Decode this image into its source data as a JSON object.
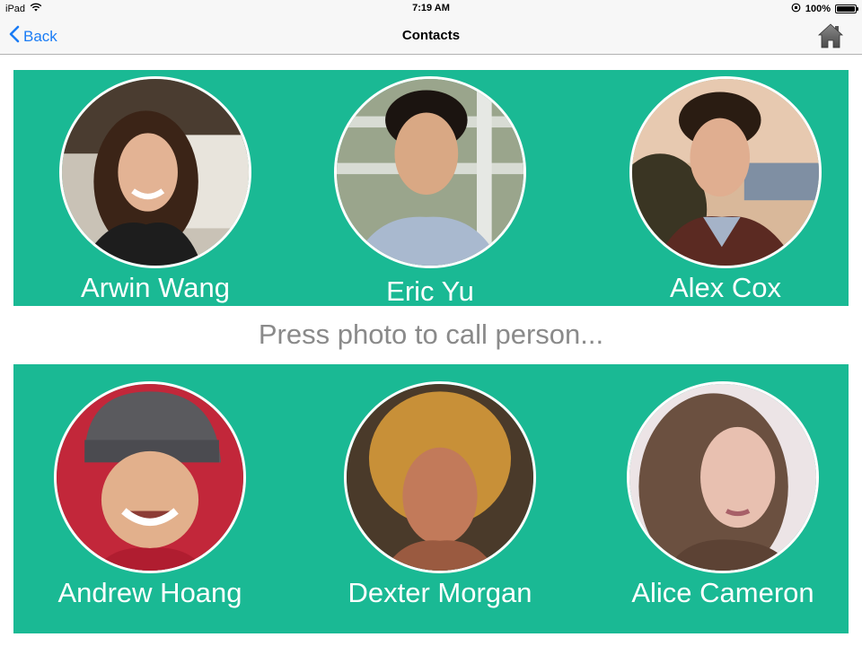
{
  "status_bar": {
    "device": "iPad",
    "time": "7:19 AM",
    "battery": "100%",
    "battery_level": 1.0
  },
  "nav": {
    "back_label": "Back",
    "title": "Contacts",
    "home_icon": "home-icon"
  },
  "hint": "Press photo to call person...",
  "contacts": [
    {
      "name": "Arwin Wang"
    },
    {
      "name": "Eric Yu"
    },
    {
      "name": "Alex Cox"
    },
    {
      "name": "Andrew Hoang"
    },
    {
      "name": "Dexter Morgan"
    },
    {
      "name": "Alice Cameron"
    }
  ],
  "colors": {
    "panel": "#1ab994",
    "accent": "#1a7cf5",
    "hint_text": "#8a8a8a"
  }
}
